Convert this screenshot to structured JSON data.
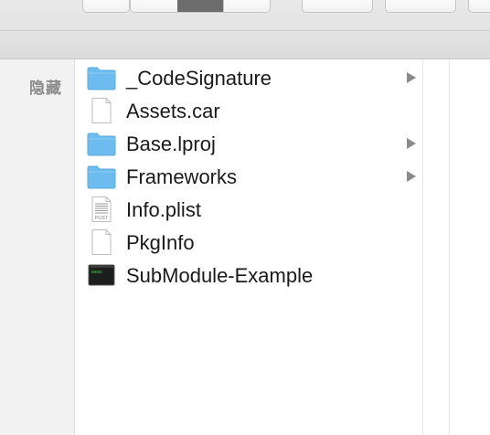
{
  "sidebar": {
    "hide_label": "隐藏"
  },
  "files": [
    {
      "name": "_CodeSignature",
      "icon": "folder-icon",
      "has_children": true
    },
    {
      "name": "Assets.car",
      "icon": "document-icon",
      "has_children": false
    },
    {
      "name": "Base.lproj",
      "icon": "folder-icon",
      "has_children": true
    },
    {
      "name": "Frameworks",
      "icon": "folder-icon",
      "has_children": true
    },
    {
      "name": "Info.plist",
      "icon": "plist-icon",
      "has_children": false,
      "icon_text": "PLIST"
    },
    {
      "name": "PkgInfo",
      "icon": "document-icon",
      "has_children": false
    },
    {
      "name": "SubModule-Example",
      "icon": "terminal-executable-icon",
      "has_children": false,
      "icon_text": "exec"
    }
  ],
  "colors": {
    "folder": "#6dbcf0",
    "sidebar_text": "#8b8b8b",
    "toolbar_active": "#6d6d6d"
  }
}
